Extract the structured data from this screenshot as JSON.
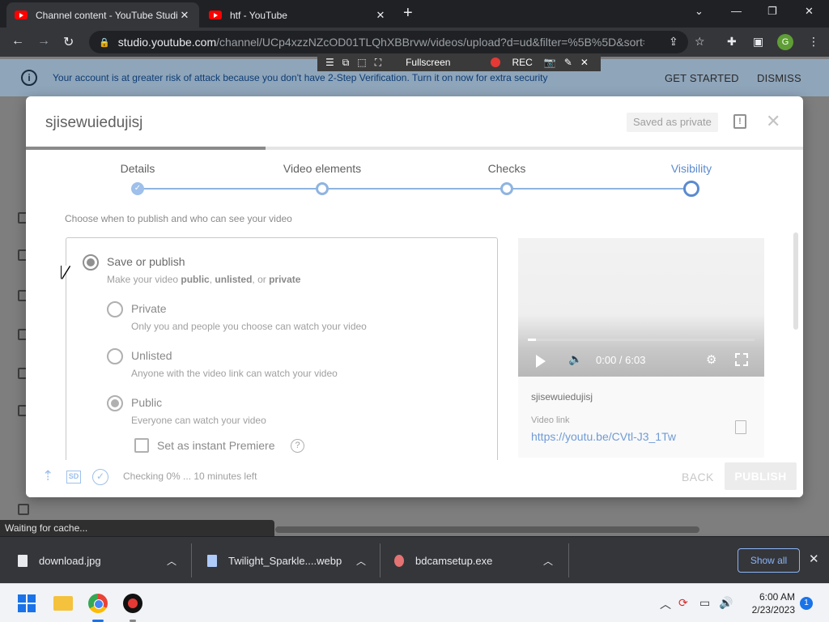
{
  "browser": {
    "tabs": [
      {
        "title": "Channel content - YouTube Studio",
        "active": true
      },
      {
        "title": "htf - YouTube",
        "active": false
      }
    ],
    "url_domain": "studio.youtube.com",
    "url_rest": "/channel/UCp4xzzNZcOD01TLQhXBBrvw/videos/upload?d=ud&filter=%5B%5D&sort=...",
    "profile_initial": "G"
  },
  "banner": {
    "message": "Your account is at greater risk of attack because you don't have 2-Step Verification. Turn it on now for extra security",
    "get_started": "GET STARTED",
    "dismiss": "DISMISS"
  },
  "recorder": {
    "fullscreen": "Fullscreen",
    "rec": "REC"
  },
  "dialog": {
    "title": "sjisewuiedujisj",
    "saved_status": "Saved as private",
    "upload_progress": 0.308,
    "steps": [
      {
        "label": "Details",
        "state": "done"
      },
      {
        "label": "Video elements",
        "state": "pending"
      },
      {
        "label": "Checks",
        "state": "pending"
      },
      {
        "label": "Visibility",
        "state": "current"
      }
    ],
    "subtitle": "Choose when to publish and who can see your video",
    "save_or_publish": {
      "title": "Save or publish",
      "desc_prefix": "Make your video ",
      "desc_public": "public",
      "desc_sep1": ", ",
      "desc_unlisted": "unlisted",
      "desc_sep2": ", or ",
      "desc_private": "private"
    },
    "options": [
      {
        "title": "Private",
        "desc": "Only you and people you choose can watch your video",
        "selected": false
      },
      {
        "title": "Unlisted",
        "desc": "Anyone with the video link can watch your video",
        "selected": false
      },
      {
        "title": "Public",
        "desc": "Everyone can watch your video",
        "selected": true
      }
    ],
    "premiere_label": "Set as instant Premiere",
    "player": {
      "time": "0:00 / 6:03"
    },
    "video_info": {
      "filename": "sjisewuiedujisj",
      "link_label": "Video link",
      "link": "https://youtu.be/CVtl-J3_1Tw"
    },
    "footer": {
      "sd_badge": "SD",
      "status": "Checking 0% ... 10 minutes left",
      "back": "BACK",
      "publish": "PUBLISH"
    }
  },
  "status_bar": "Waiting for cache...",
  "downloads": [
    {
      "name": "download.jpg"
    },
    {
      "name": "Twilight_Sparkle....webp"
    },
    {
      "name": "bdcamsetup.exe"
    }
  ],
  "downloads_show_all": "Show all",
  "taskbar": {
    "time": "6:00 AM",
    "date": "2/23/2023",
    "notifications": "1"
  }
}
